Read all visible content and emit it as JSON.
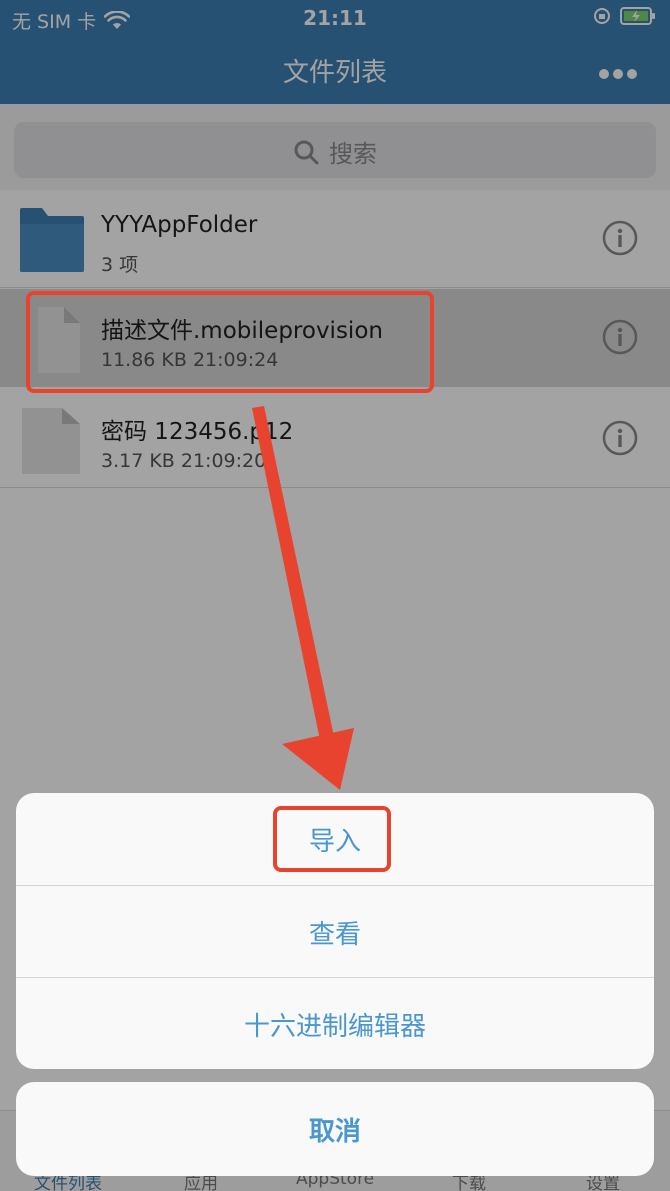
{
  "status_bar": {
    "carrier": "无 SIM 卡",
    "time": "21:11"
  },
  "nav": {
    "title": "文件列表",
    "more_icon": "ellipsis-icon"
  },
  "search": {
    "placeholder": "搜索"
  },
  "files": [
    {
      "name": "YYYAppFolder",
      "meta": "3 项",
      "type": "folder"
    },
    {
      "name": "描述文件.mobileprovision",
      "meta": "11.86 KB   21:09:24",
      "type": "file"
    },
    {
      "name": "密码 123456.p12",
      "meta": "3.17 KB   21:09:20",
      "type": "file"
    }
  ],
  "tabs": [
    {
      "label": "文件列表"
    },
    {
      "label": "应用"
    },
    {
      "label": "AppStore"
    },
    {
      "label": "下载"
    },
    {
      "label": "设置"
    }
  ],
  "action_sheet": {
    "actions": [
      {
        "label": "导入"
      },
      {
        "label": "查看"
      },
      {
        "label": "十六进制编辑器"
      }
    ],
    "cancel": "取消"
  },
  "colors": {
    "nav": "#3e7fb3",
    "action": "#4a97cf",
    "highlight": "#e8432e"
  }
}
